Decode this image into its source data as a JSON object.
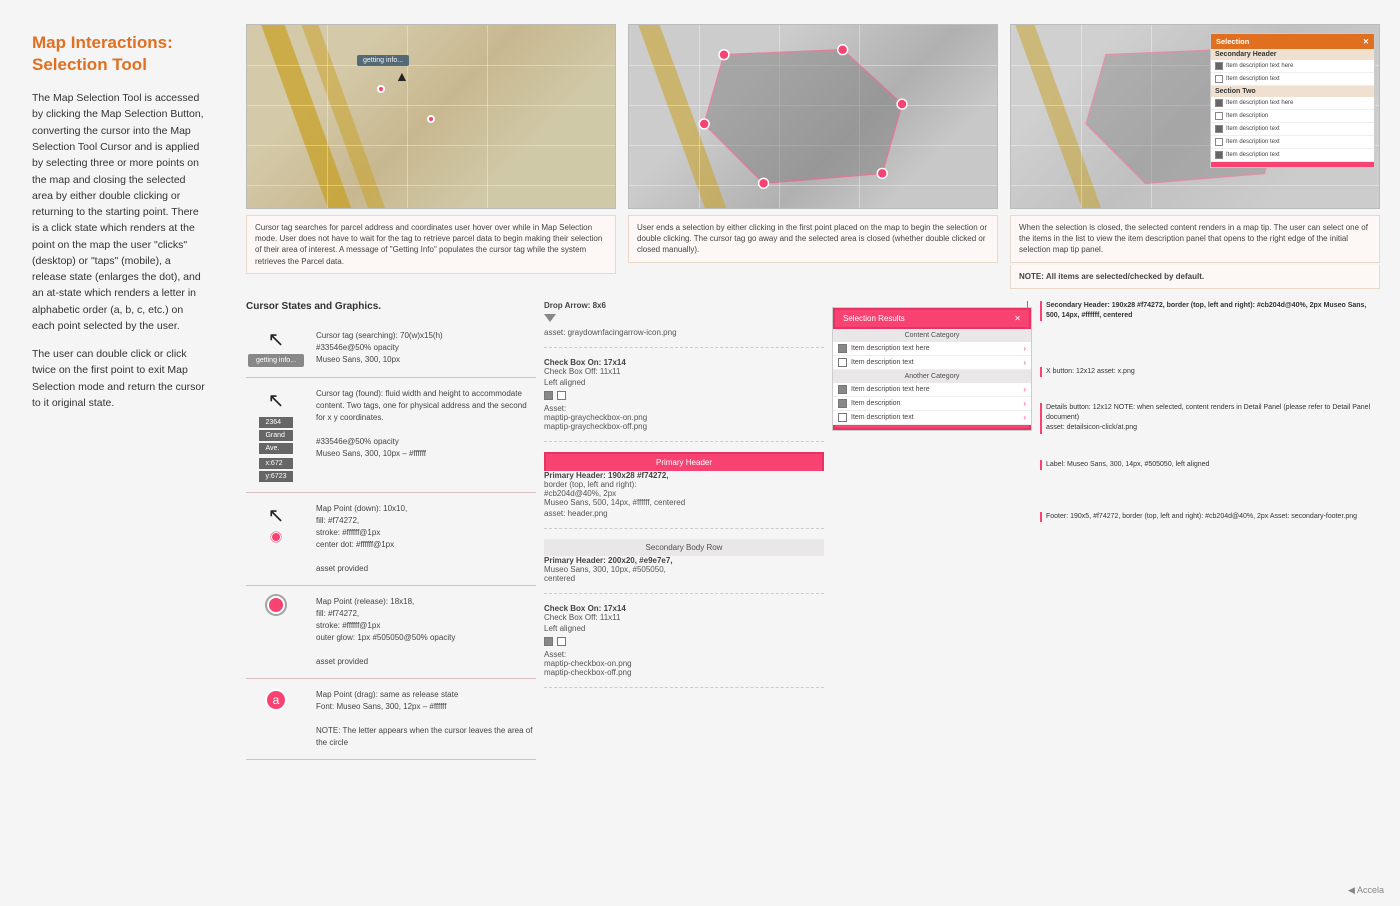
{
  "sidebar": {
    "title": "Map Interactions:\nSelection Tool",
    "paragraphs": [
      "The Map Selection Tool is accessed by clicking the Map Selection Button, converting the cursor into the Map Selection Tool Cursor and is applied by selecting three or more points on the map and closing the selected area by either double clicking or returning to the starting point. There is a click state which renders at the point on the map the user \"clicks\" (desktop) or \"taps\" (mobile), a release state (enlarges the dot), and an at-state which renders a letter in alphabetic order (a, b, c, etc.) on each point selected by the user.",
      "The user can double click or click twice on the first point to exit Map Selection mode and return the cursor to it original state."
    ]
  },
  "maps": {
    "caption1": "Cursor tag searches for parcel address and coordinates user hover over while in Map Selection mode. User does not have to wait for the tag to retrieve parcel data to begin making their selection of their area of interest. A message of \"Getting Info\" populates the cursor tag while the system retrieves the Parcel data.",
    "caption2": "User ends a selection by either clicking in the first point placed on the map to begin the selection or double clicking. The cursor tag go away and the selected area is closed (whether double clicked or closed manually).",
    "caption3": "When the selection is closed, the selected content renders in a map tip. The user can select one of the items in the list to view the item description panel that opens to the right edge of the initial selection map tip panel.",
    "note3": "NOTE: All items are selected/checked by default."
  },
  "cursor_states_title": "Cursor States and Graphics.",
  "cursor_items": [
    {
      "icon": "arrow",
      "tag": "getting info...",
      "desc": "Cursor tag (searching): 70(w)x15(h)\n#33546e@50% opacity\nMuseo Sans, 300, 10px"
    },
    {
      "icon": "arrow",
      "tag_multi": [
        "2364",
        "Grand",
        "Ave.",
        "x:672",
        "y:6723"
      ],
      "desc": "Cursor tag (found): fluid width and height to accommodate content. Two tags, one for physical address and the second for x y coordinates.\n\n#33546e@50% opacity\nMuseo Sans, 300, 10px – #ffffff"
    },
    {
      "icon": "down",
      "desc": "Map Point (down): 10x10,\nfill: #f74272,\nstroke: #ffffff@1px\ncenter dot: #ffffff@1px\n\nasset provided"
    },
    {
      "icon": "release",
      "desc": "Map Point (release): 18x18,\nfill: #f74272,\nstroke: #ffffff@1px\nouter glow: 1px #505050@50% opacity\n\nasset provided"
    },
    {
      "icon": "drag",
      "desc": "Map Point (drag): same as release state\nFont: Museo Sans, 300, 12px – #ffffff\n\nNOTE: The letter appears when the cursor leaves the area of the circle"
    }
  ],
  "spec_middle": {
    "drop_arrow": {
      "label": "Drop Arrow: 8x6",
      "asset": "asset: graydownfacingarrow-icon.png"
    },
    "checkbox_on": {
      "label": "Check Box On: 17x14",
      "sub": "Check Box Off: 11x11",
      "align": "Left aligned"
    },
    "checkbox_asset": "Asset:\nmaptip-graycheckbox-on.png\nmaptip-graycheckbox-off.png",
    "primary_header": {
      "label": "Primary Header: 190x28 #f74272,",
      "detail": "border (top, left and right):\n#cb204d@40%, 2px\nMuseo Sans, 500, 14px, #ffffff, centered"
    },
    "primary_header_asset": "asset: header.png",
    "secondary_body": {
      "label": "Primary Header: 200x20, #e9e7e7,",
      "detail": "Museo Sans, 300, 10px, #505050,\ncentered"
    },
    "checkbox_on2": {
      "label": "Check Box On: 17x14",
      "sub": "Check Box Off: 11x11",
      "align": "Left aligned"
    },
    "checkbox_asset2": "Asset:\nmaptip-checkbox-on.png\nmaptip-checkbox-off.png"
  },
  "spec_right": {
    "secondary_header": "Secondary Header: 190x28 #f74272,\nborder (top, left and right):\n#cb204d@40%, 2px\nMuseo Sans, 500, 14px, #ffffff, centered",
    "secondary_header_asset": "asset: header.png",
    "x_button": "X button: 12x12\nasset: x.png",
    "details_button": "Details button: 12x12\n\nNOTE: when selected, content renders\nin Detail Panel (please refer to Detail\nPanel document)",
    "details_asset": "asset: detailsicon-click/at.png",
    "label_spec": "Label: Museo Sans, 300, 14px,\n#505050, left aligned",
    "footer": "Footer: 190x5, #f74272,\nborder (top, left and right):\n#cb204d@40%, 2px\n\nAsset: secondary-footer.png"
  },
  "branding": "◀ Accela"
}
